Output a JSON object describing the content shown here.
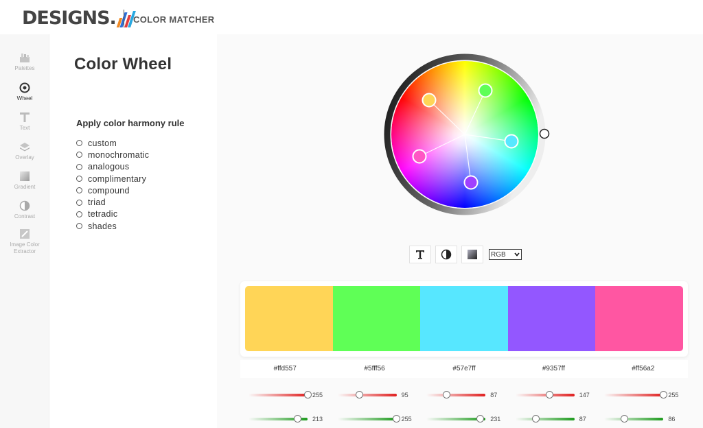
{
  "header": {
    "logo_text": "DESIGNS.",
    "app_title": "COLOR MATCHER"
  },
  "sidebar": {
    "items": [
      {
        "label": "Palettes",
        "icon": "palettes-icon"
      },
      {
        "label": "Wheel",
        "icon": "wheel-icon"
      },
      {
        "label": "Text",
        "icon": "text-icon"
      },
      {
        "label": "Overlay",
        "icon": "overlay-icon"
      },
      {
        "label": "Gradient",
        "icon": "gradient-icon"
      },
      {
        "label": "Contrast",
        "icon": "contrast-icon"
      },
      {
        "label": "Image Color Extractor",
        "icon": "image-extractor-icon"
      }
    ]
  },
  "page": {
    "title": "Color Wheel",
    "harmony_title": "Apply color harmony rule",
    "harmony_options": [
      "custom",
      "monochromatic",
      "analogous",
      "complimentary",
      "compound",
      "triad",
      "tetradic",
      "shades"
    ]
  },
  "toolbar": {
    "mode_selected": "RGB"
  },
  "palette": {
    "swatches": [
      {
        "hex": "#ffd557",
        "color": "#ffd557",
        "r": 255,
        "g": 213
      },
      {
        "hex": "#5fff56",
        "color": "#5fff56",
        "r": 95,
        "g": 255
      },
      {
        "hex": "#57e7ff",
        "color": "#57e7ff",
        "r": 87,
        "g": 231
      },
      {
        "hex": "#9357ff",
        "color": "#9357ff",
        "r": 147,
        "g": 87
      },
      {
        "hex": "#ff56a2",
        "color": "#ff56a2",
        "r": 255,
        "g": 86
      }
    ]
  },
  "colors": {
    "red_track": "#e02020",
    "green_track": "#1e9b1e"
  }
}
